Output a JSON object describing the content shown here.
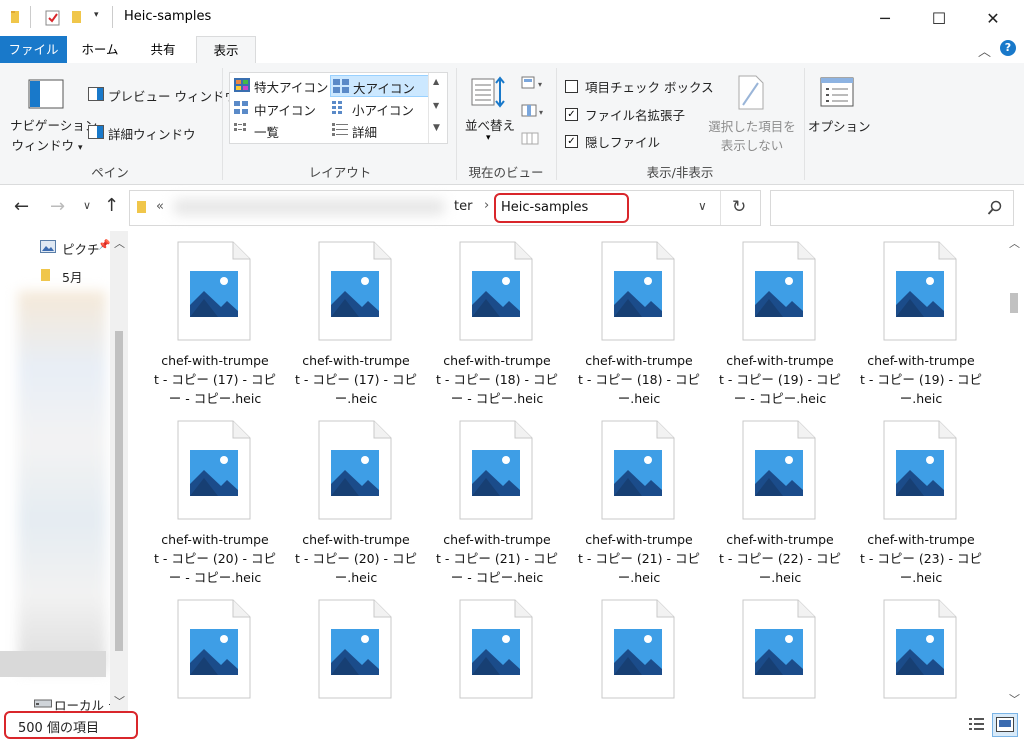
{
  "window": {
    "title": "Heic-samples",
    "minimize_icon": "minimize-icon",
    "maximize_icon": "maximize-icon",
    "close_icon": "close-icon"
  },
  "tabs": [
    {
      "label": "ファイル"
    },
    {
      "label": "ホーム"
    },
    {
      "label": "共有"
    },
    {
      "label": "表示"
    }
  ],
  "ribbon": {
    "pane": {
      "nav_pane_line1": "ナビゲーション",
      "nav_pane_line2": "ウィンドウ",
      "preview": "プレビュー ウィンドウ",
      "details": "詳細ウィンドウ",
      "group_label": "ペイン"
    },
    "layout": {
      "items": [
        "特大アイコン",
        "大アイコン",
        "中アイコン",
        "小アイコン",
        "一覧",
        "詳細"
      ],
      "group_label": "レイアウト"
    },
    "current_view": {
      "sort": "並べ替え",
      "group_label": "現在のビュー"
    },
    "show_hide": {
      "item_checkbox": "項目チェック ボックス",
      "file_ext": "ファイル名拡張子",
      "hidden_files": "隠しファイル",
      "hide_selected_line1": "選択した項目を",
      "hide_selected_line2": "表示しない",
      "group_label": "表示/非表示"
    },
    "options": "オプション"
  },
  "address": {
    "prefix": "«",
    "partial": "ter",
    "separator": "›",
    "current": "Heic-samples",
    "search_placeholder": ""
  },
  "navpane": {
    "items": [
      {
        "label": "ピクチ",
        "icon": "pictures-icon"
      },
      {
        "label": "5月",
        "icon": "folder-icon"
      },
      {
        "label": "ローカル デ",
        "icon": "drive-icon"
      }
    ]
  },
  "files": [
    {
      "line1": "chef-with-trumpe",
      "line2": "t - コピー (17) - コピ",
      "line3": "ー - コピー.heic"
    },
    {
      "line1": "chef-with-trumpe",
      "line2": "t - コピー (17) - コピ",
      "line3": "ー.heic"
    },
    {
      "line1": "chef-with-trumpe",
      "line2": "t - コピー (18) - コピ",
      "line3": "ー - コピー.heic"
    },
    {
      "line1": "chef-with-trumpe",
      "line2": "t - コピー (18) - コピ",
      "line3": "ー.heic"
    },
    {
      "line1": "chef-with-trumpe",
      "line2": "t - コピー (19) - コピ",
      "line3": "ー - コピー.heic"
    },
    {
      "line1": "chef-with-trumpe",
      "line2": "t - コピー (19) - コピ",
      "line3": "ー.heic"
    },
    {
      "line1": "chef-with-trumpe",
      "line2": "t - コピー (20) - コピ",
      "line3": "ー - コピー.heic"
    },
    {
      "line1": "chef-with-trumpe",
      "line2": "t - コピー (20) - コピ",
      "line3": "ー.heic"
    },
    {
      "line1": "chef-with-trumpe",
      "line2": "t - コピー (21) - コピ",
      "line3": "ー - コピー.heic"
    },
    {
      "line1": "chef-with-trumpe",
      "line2": "t - コピー (21) - コピ",
      "line3": "ー.heic"
    },
    {
      "line1": "chef-with-trumpe",
      "line2": "t - コピー (22) - コピ",
      "line3": "ー.heic"
    },
    {
      "line1": "chef-with-trumpe",
      "line2": "t - コピー (23) - コピ",
      "line3": "ー.heic"
    }
  ],
  "status": {
    "item_count": "500 個の項目"
  },
  "colors": {
    "accent": "#1979ca",
    "highlight": "#d9262b",
    "selected_layout": "#cce8ff"
  }
}
